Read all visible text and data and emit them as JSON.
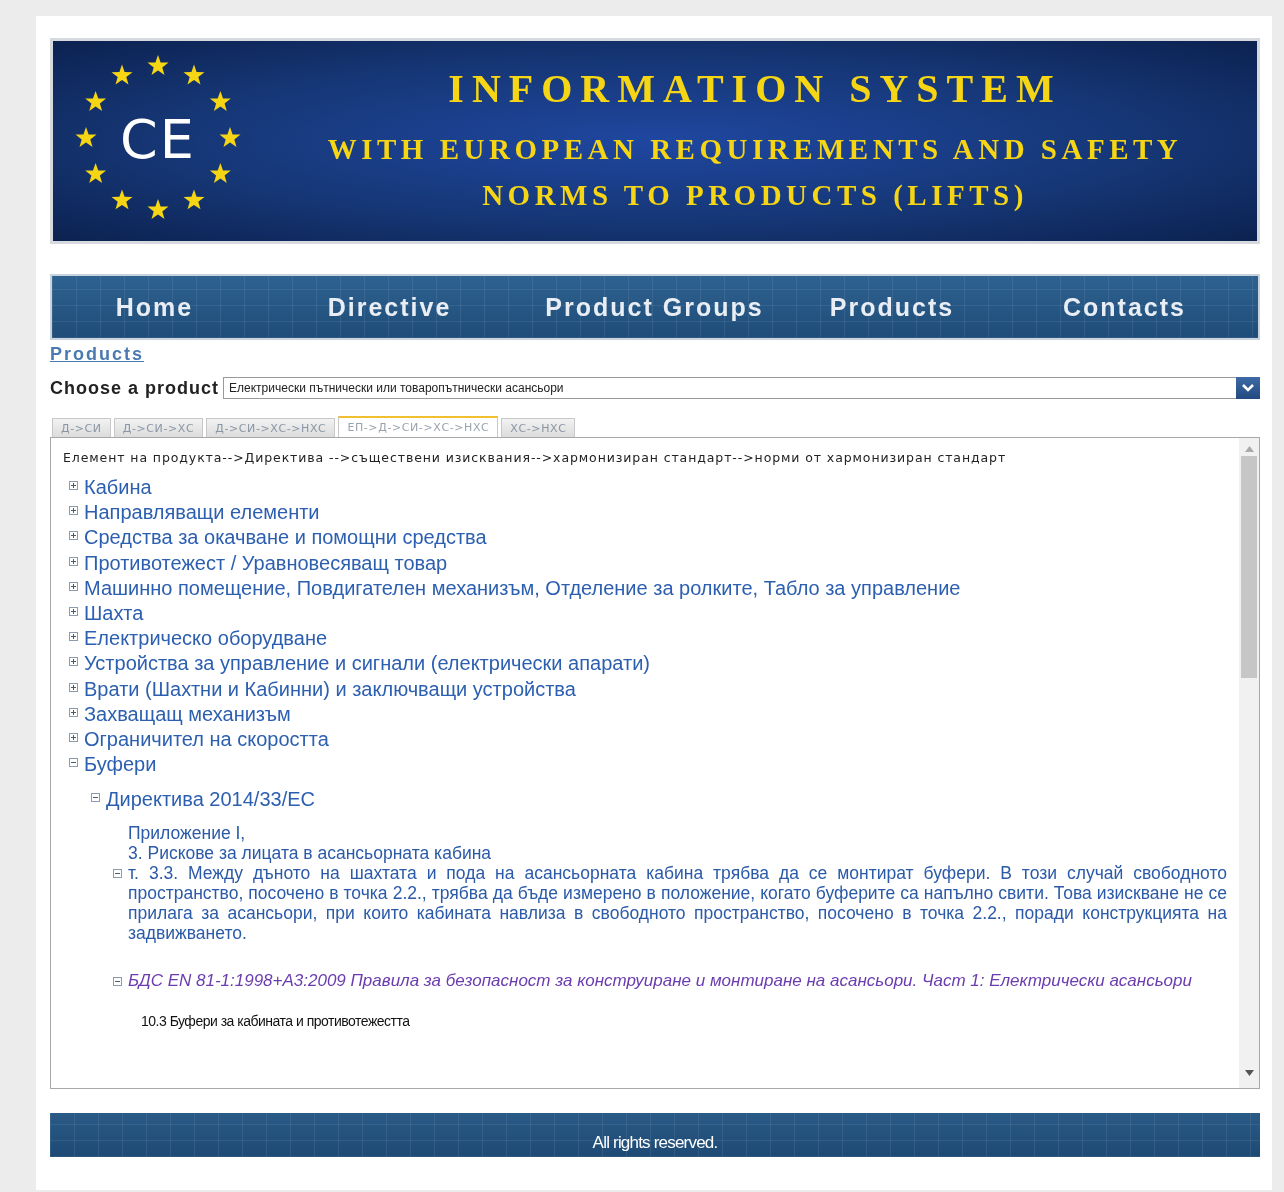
{
  "header": {
    "logo_text": "CE",
    "title": "INFORMATION SYSTEM",
    "subtitle_lines": [
      "WITH EUROPEAN REQUIREMENTS AND SAFETY",
      "NORMS TO PRODUCTS (LIFTS)"
    ]
  },
  "nav": [
    {
      "label": "Home"
    },
    {
      "label": "Directive"
    },
    {
      "label": "Product Groups"
    },
    {
      "label": "Products"
    },
    {
      "label": "Contacts"
    }
  ],
  "breadcrumb": "Products",
  "product_select": {
    "label": "Choose a product",
    "value": "Електрически пътнически или товаропътнически асансьори"
  },
  "tabs": [
    {
      "label": "Д->СИ",
      "selected": false
    },
    {
      "label": "Д->СИ->ХС",
      "selected": false
    },
    {
      "label": "Д->СИ->ХС->НХС",
      "selected": false
    },
    {
      "label": "ЕП->Д->СИ->ХС->НХС",
      "selected": true
    },
    {
      "label": "ХС->НХС",
      "selected": false
    }
  ],
  "content": {
    "heading": "Елемент на продукта-->Директива -->съществени изисквания-->хармонизиран стандарт-->норми от хармонизиран стандарт",
    "tree": [
      {
        "kind": "element",
        "label": "Кабина",
        "expanded": false
      },
      {
        "kind": "element",
        "label": "Направляващи елементи",
        "expanded": false
      },
      {
        "kind": "element",
        "label": "Средства за окачване и помощни средства",
        "expanded": false
      },
      {
        "kind": "element",
        "label": "Противотежест / Уравновесяващ товар",
        "expanded": false
      },
      {
        "kind": "element",
        "label": "Машинно помещение, Повдигателен механизъм, Отделение за ролките, Табло за управление",
        "expanded": false
      },
      {
        "kind": "element",
        "label": "Шахта",
        "expanded": false
      },
      {
        "kind": "element",
        "label": "Електрическо оборудване",
        "expanded": false
      },
      {
        "kind": "element",
        "label": "Устройства за управление и сигнали (електрически апарати)",
        "expanded": false
      },
      {
        "kind": "element",
        "label": "Врати (Шахтни и Кабинни) и заключващи устройства",
        "expanded": false
      },
      {
        "kind": "element",
        "label": "Захващащ механизъм",
        "expanded": false
      },
      {
        "kind": "element",
        "label": "Ограничител на скоростта",
        "expanded": false
      },
      {
        "kind": "element",
        "label": "Буфери",
        "expanded": true,
        "children": [
          {
            "kind": "directive",
            "label": "Директива 2014/33/ЕС",
            "expanded": true,
            "children": [
              {
                "kind": "requirement",
                "lines": [
                  "Приложение I,",
                  "3. Рискове за лицата в асансьорната кабина",
                  "т. 3.3. Между дъното на шахтата и пода на асансьорната кабина трябва да се монтират буфери. В този случай свободното пространство, посочено в точка 2.2., трябва да бъде измерено в положение, когато буферите са напълно свити. Това изискване не се прилага за асансьори, при които кабината навлиза в свободното пространство, посочено в точка 2.2., поради конструкцията на задвижването."
                ],
                "expanded": true,
                "children": [
                  {
                    "kind": "standard",
                    "label": "БДС EN 81-1:1998+A3:2009 Правила за безопасност за конструиране и монтиране на асансьори. Част 1: Електрически асансьори",
                    "expanded": true,
                    "children": [
                      {
                        "kind": "norm",
                        "label": "10.3 Буфери за кабината и противотежестта"
                      }
                    ]
                  }
                ]
              }
            ]
          }
        ]
      }
    ]
  },
  "footer": "All rights reserved."
}
